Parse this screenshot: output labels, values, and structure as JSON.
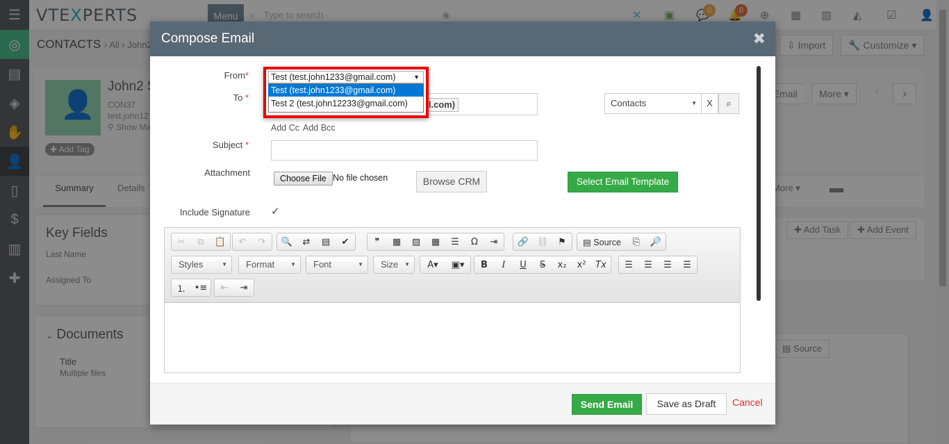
{
  "topbar": {
    "logo_a": "VTE",
    "logo_x": "X",
    "logo_b": "PERTS",
    "menu_label": "Menu",
    "search_placeholder": "Type to search",
    "badge_chat": "0",
    "badge_bell": "0"
  },
  "background": {
    "breadcrumb_module": "CONTACTS",
    "breadcrumb_all": "All",
    "breadcrumb_record": "John2 Sm",
    "contact_name": "John2 S",
    "contact_id": "CON37",
    "contact_email": "test.john12",
    "show_map": "Show Ma",
    "add_tag": "Add Tag",
    "import_label": "Import",
    "customize_label": "Customize",
    "send_email_label": "d Email",
    "more_label": "More",
    "tab_summary": "Summary",
    "tab_details": "Details",
    "tab_more": "More",
    "key_fields": "Key Fields",
    "last_name": "Last Name",
    "assigned_to": "Assigned To",
    "add_task": "Add Task",
    "add_event": "Add Event",
    "documents": "Documents",
    "doc_title": "Title",
    "doc_value": "Multiple files",
    "source_label": "Source"
  },
  "modal": {
    "title": "Compose Email",
    "from_label": "From",
    "to_label": "To",
    "from_value": "Test (test.john1233@gmail.com)",
    "to_chip": "ail.com)",
    "add_cc": "Add Cc",
    "add_bcc": "Add Bcc",
    "subject_label": "Subject",
    "attachment_label": "Attachment",
    "choose_file": "Choose File",
    "no_file": "No file chosen",
    "browse_crm": "Browse CRM",
    "select_template": "Select Email Template",
    "include_signature": "Include Signature",
    "module_select": "Contacts",
    "clear_x": "X",
    "from_options": [
      "Test (test.john1233@gmail.com)",
      "Test 2 (test.john12233@gmail.com)"
    ],
    "send_email": "Send Email",
    "save_draft": "Save as Draft",
    "cancel": "Cancel"
  },
  "editor": {
    "styles": "Styles",
    "format": "Format",
    "font": "Font",
    "size": "Size",
    "source": "Source"
  },
  "colors": {
    "modal_header": "#596875",
    "sidebar": "#5f6165",
    "primary_green": "#35aa47",
    "highlight": "#0078d7",
    "red_box": "#e00000"
  }
}
